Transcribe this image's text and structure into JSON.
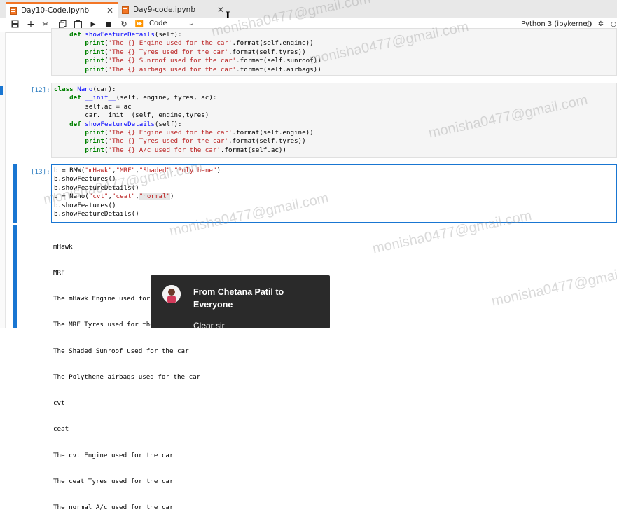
{
  "tabs": [
    {
      "label": "Day10-Code.ipynb",
      "active": true
    },
    {
      "label": "Day9-code.ipynb",
      "active": false
    }
  ],
  "toolbar": {
    "cell_type": "Code",
    "kernel": "Python 3 (ipykernel)"
  },
  "cells": {
    "c11_lines": [
      "    def showFeatureDetails(self):",
      "        print('The {} Engine used for the car'.format(self.engine))",
      "        print('The {} Tyres used for the car'.format(self.tyres))",
      "        print('The {} Sunroof used for the car'.format(self.sunroof))",
      "        print('The {} airbags used for the car'.format(self.airbags))"
    ],
    "c12_prompt": "[12]:",
    "c12_lines": [
      "class Nano(car):",
      "    def __init__(self, engine, tyres, ac):",
      "        self.ac = ac",
      "        car.__init__(self, engine,tyres)",
      "    def showFeatureDetails(self):",
      "        print('The {} Engine used for the car'.format(self.engine))",
      "        print('The {} Tyres used for the car'.format(self.tyres))",
      "        print('The {} A/c used for the car'.format(self.ac))"
    ],
    "c13_prompt": "[13]:",
    "c13_lines": [
      "b = BMW(\"mHawk\",\"MRF\",\"Shaded\",\"Polythene\")",
      "b.showFeatures()",
      "b.showFeatureDetails()",
      "b = Nano(\"cvt\",\"ceat\",\"normal\")",
      "b.showFeatures()",
      "b.showFeatureDetails()"
    ],
    "output_lines": [
      "mHawk",
      "MRF",
      "The mHawk Engine used for the car",
      "The MRF Tyres used for the car",
      "The Shaded Sunroof used for the car",
      "The Polythene airbags used for the car",
      "cvt",
      "ceat",
      "The cvt Engine used for the car",
      "The ceat Tyres used for the car",
      "The normal A/c used for the car"
    ]
  },
  "watermark": "monisha0477@gmail.com",
  "notification": {
    "title": "From Chetana Patil to Everyone",
    "message": "Clear sir"
  }
}
